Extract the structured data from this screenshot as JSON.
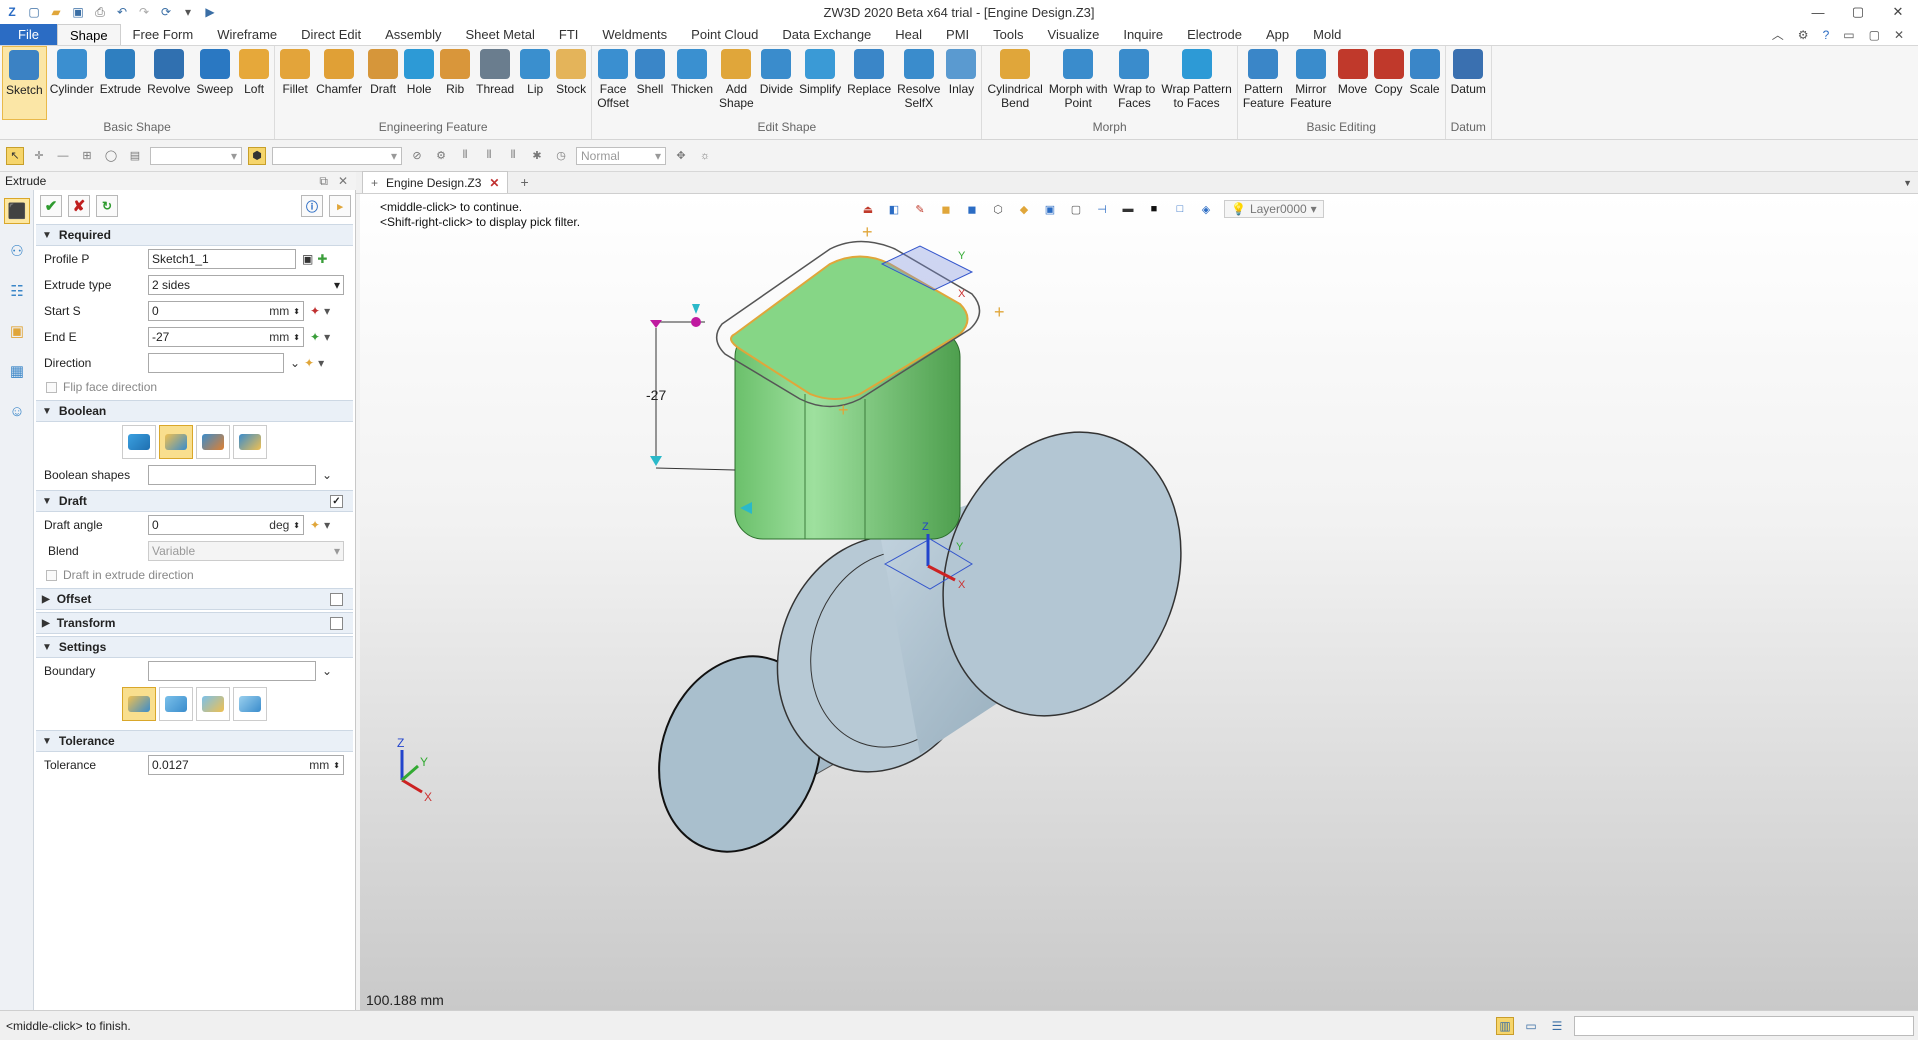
{
  "window": {
    "title": "ZW3D 2020 Beta x64 trial - [Engine Design.Z3]"
  },
  "quick_access": [
    "new-icon",
    "open-icon",
    "save-icon",
    "print-icon",
    "undo-icon",
    "redo-icon",
    "refresh-icon",
    "more-icon",
    "run-icon"
  ],
  "menu": {
    "tabs": [
      "File",
      "Shape",
      "Free Form",
      "Wireframe",
      "Direct Edit",
      "Assembly",
      "Sheet Metal",
      "FTI",
      "Weldments",
      "Point Cloud",
      "Data Exchange",
      "Heal",
      "PMI",
      "Tools",
      "Visualize",
      "Inquire",
      "Electrode",
      "App",
      "Mold"
    ],
    "active": "Shape"
  },
  "ribbon": {
    "groups": [
      {
        "name": "Basic Shape",
        "buttons": [
          {
            "label": "Sketch",
            "color": "#3b82c4",
            "sel": true
          },
          {
            "label": "Cylinder",
            "color": "#3b8fd0"
          },
          {
            "label": "Extrude",
            "color": "#2f7fc0"
          },
          {
            "label": "Revolve",
            "color": "#3070b0"
          },
          {
            "label": "Sweep",
            "color": "#2a78c2"
          },
          {
            "label": "Loft",
            "color": "#e6a83a"
          }
        ]
      },
      {
        "name": "Engineering Feature",
        "buttons": [
          {
            "label": "Fillet",
            "color": "#e3a43a"
          },
          {
            "label": "Chamfer",
            "color": "#e0a036"
          },
          {
            "label": "Draft",
            "color": "#d6963a"
          },
          {
            "label": "Hole",
            "color": "#2d9ad6"
          },
          {
            "label": "Rib",
            "color": "#d9963a"
          },
          {
            "label": "Thread",
            "color": "#6a7d8e"
          },
          {
            "label": "Lip",
            "color": "#3a8fce"
          },
          {
            "label": "Stock",
            "color": "#e4b45a"
          }
        ]
      },
      {
        "name": "Edit Shape",
        "buttons": [
          {
            "label": "Face\nOffset",
            "color": "#3a8fd0"
          },
          {
            "label": "Shell",
            "color": "#3a86c8"
          },
          {
            "label": "Thicken",
            "color": "#3a90d0"
          },
          {
            "label": "Add\nShape",
            "color": "#e0a63a"
          },
          {
            "label": "Divide",
            "color": "#3a8ccc"
          },
          {
            "label": "Simplify",
            "color": "#3a9ad6"
          },
          {
            "label": "Replace",
            "color": "#3a86c8"
          },
          {
            "label": "Resolve\nSelfX",
            "color": "#3a8ccc"
          },
          {
            "label": "Inlay",
            "color": "#5a9ad0"
          }
        ]
      },
      {
        "name": "Morph",
        "buttons": [
          {
            "label": "Cylindrical\nBend",
            "color": "#e0a63a"
          },
          {
            "label": "Morph with\nPoint",
            "color": "#3a8ccc"
          },
          {
            "label": "Wrap to\nFaces",
            "color": "#3a8ccc"
          },
          {
            "label": "Wrap Pattern\nto Faces",
            "color": "#2d9ad6"
          }
        ]
      },
      {
        "name": "Basic Editing",
        "buttons": [
          {
            "label": "Pattern\nFeature",
            "color": "#3a86c8"
          },
          {
            "label": "Mirror\nFeature",
            "color": "#3a8ccc"
          },
          {
            "label": "Move",
            "color": "#c0392b"
          },
          {
            "label": "Copy",
            "color": "#c0392b"
          },
          {
            "label": "Scale",
            "color": "#3a86c8"
          }
        ]
      },
      {
        "name": "Datum",
        "buttons": [
          {
            "label": "Datum",
            "color": "#3a70b0"
          }
        ]
      }
    ]
  },
  "toolbar2": {
    "render_mode": "Normal"
  },
  "panel": {
    "title": "Extrude",
    "required": {
      "title": "Required",
      "profile": {
        "label": "Profile P",
        "value": "Sketch1_1"
      },
      "extrude_type": {
        "label": "Extrude type",
        "value": "2 sides"
      },
      "start": {
        "label": "Start S",
        "value": "0",
        "unit": "mm"
      },
      "end": {
        "label": "End E",
        "value": "-27",
        "unit": "mm"
      },
      "direction": {
        "label": "Direction",
        "value": ""
      },
      "flip": "Flip face direction"
    },
    "boolean": {
      "title": "Boolean",
      "shapes_label": "Boolean shapes"
    },
    "draft": {
      "title": "Draft",
      "angle_label": "Draft angle",
      "angle": "0",
      "unit": "deg",
      "blend_label": "Blend",
      "blend": "Variable",
      "in_dir": "Draft in extrude direction"
    },
    "offset": {
      "title": "Offset"
    },
    "transform": {
      "title": "Transform"
    },
    "settings": {
      "title": "Settings",
      "boundary_label": "Boundary"
    },
    "tolerance": {
      "title": "Tolerance",
      "label": "Tolerance",
      "value": "0.0127",
      "unit": "mm"
    }
  },
  "doc": {
    "tab": "Engine Design.Z3"
  },
  "viewport": {
    "hint1": "<middle-click> to continue.",
    "hint2": "<Shift-right-click> to display pick filter.",
    "layer": "Layer0000",
    "dimension": "-27",
    "scale": "100.188 mm",
    "axis_labels": {
      "x": "X",
      "y": "Y",
      "z": "Z"
    }
  },
  "status": {
    "message": "<middle-click> to finish."
  }
}
